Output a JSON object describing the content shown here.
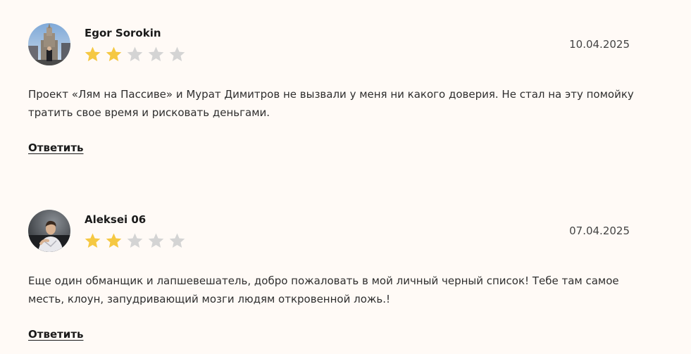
{
  "colors": {
    "background": "#fffaf6",
    "star_filled": "#f5c842",
    "star_empty": "#d4d4d4",
    "text": "#2e2e2e"
  },
  "reviews": [
    {
      "author": "Egor Sorokin",
      "date": "10.04.2025",
      "rating": 2,
      "max_rating": 5,
      "text": "Проект «Лям на Пассиве» и Мурат Димитров не вызвали у меня ни какого доверия. Не стал на эту помойку тратить свое время и рисковать деньгами.",
      "reply_label": "Ответить",
      "avatar_icon": "city-tower-photo-avatar"
    },
    {
      "author": "Aleksei 06",
      "date": "07.04.2025",
      "rating": 2,
      "max_rating": 5,
      "text": "Еще один обманщик и лапшевешатель, добро пожаловать в мой личный черный список! Тебе там самое месть, клоун, запудривающий мозги людям откровенной ложь.!",
      "reply_label": "Ответить",
      "avatar_icon": "man-portrait-photo-avatar"
    }
  ]
}
